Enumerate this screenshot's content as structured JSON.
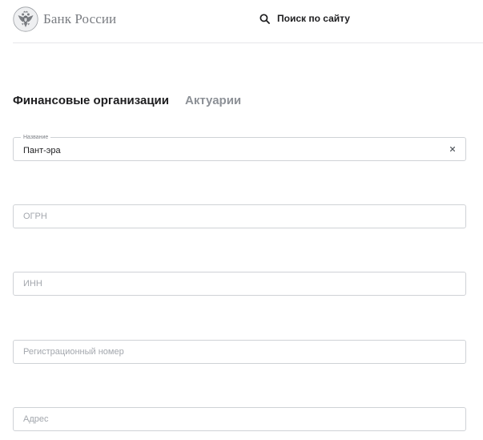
{
  "header": {
    "logo_text": "Банк России",
    "search_label": "Поиск по сайту"
  },
  "tabs": [
    {
      "label": "Финансовые организации",
      "active": true
    },
    {
      "label": "Актуарии",
      "active": false
    }
  ],
  "form": {
    "name_field": {
      "label": "Название",
      "value": "Пант-эра"
    },
    "ogrn_field": {
      "placeholder": "ОГРН",
      "value": ""
    },
    "inn_field": {
      "placeholder": "ИНН",
      "value": ""
    },
    "reg_number_field": {
      "placeholder": "Регистрационный номер",
      "value": ""
    },
    "address_field": {
      "placeholder": "Адрес",
      "value": ""
    }
  },
  "icons": {
    "logo": "double-headed-eagle-icon",
    "search": "search-icon",
    "clear": "close-icon"
  },
  "colors": {
    "text": "#1d1d1f",
    "muted_tab": "#8c9096",
    "logo_gray": "#7a7d82",
    "border": "#cfd2d6",
    "placeholder": "#a3a7ad"
  }
}
